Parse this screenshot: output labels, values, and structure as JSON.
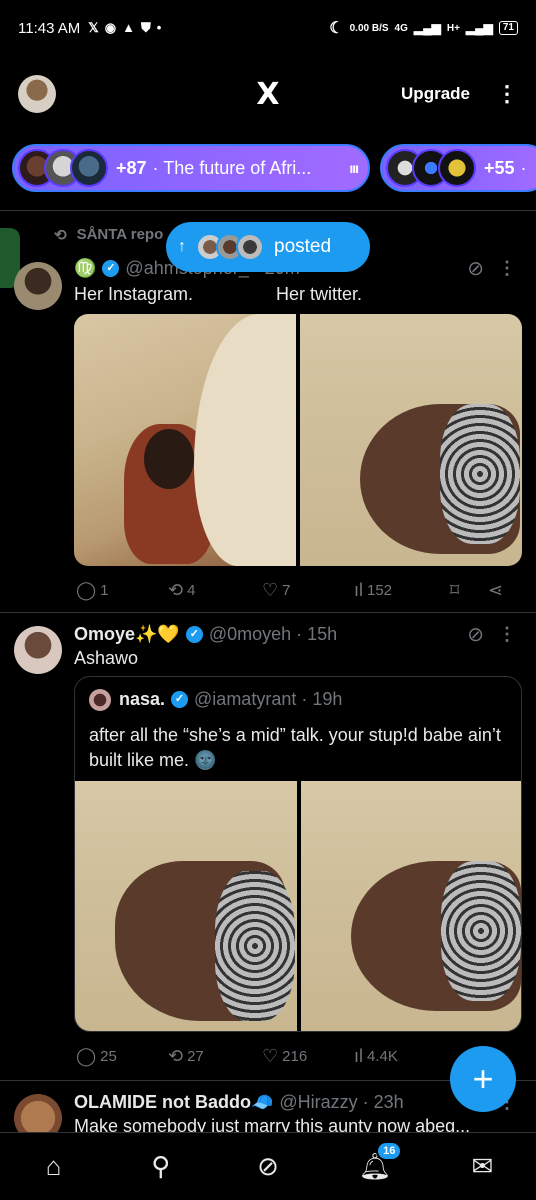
{
  "status_bar": {
    "time": "11:43 AM",
    "notif_icons": [
      "x-icon",
      "chat-icon",
      "warning-icon",
      "shield-icon"
    ],
    "data_speed": "0.00 B/S",
    "network": "4G",
    "network2": "H+",
    "battery": "71"
  },
  "header": {
    "logo": "X",
    "upgrade_label": "Upgrade"
  },
  "spaces": [
    {
      "count": "+87",
      "title": "· The future of Afri..."
    },
    {
      "count": "+55",
      "title": "·"
    }
  ],
  "posted_pill": {
    "label": "posted"
  },
  "feed": [
    {
      "repost_by": "SÅNTA repo",
      "name": "♍",
      "verified": true,
      "handle": "@ahmstopher_ · 20m",
      "text_left": "Her Instagram.",
      "text_right": "Her twitter.",
      "stats": {
        "replies": "1",
        "reposts": "4",
        "likes": "7",
        "views": "152"
      }
    },
    {
      "name": "Omoye✨💛",
      "verified": true,
      "handle": "@0moyeh · 15h",
      "text": "Ashawo",
      "quote": {
        "name": "nasa.",
        "verified": true,
        "handle": "@iamatyrant · 19h",
        "text": "after all the “she’s a mid” talk. your stup!d babe ain’t built like me. 🌚"
      },
      "stats": {
        "replies": "25",
        "reposts": "27",
        "likes": "216",
        "views": "4.4K"
      }
    },
    {
      "name": "OLAMIDE not Baddo🧢",
      "handle": "@Hirazzy · 23h",
      "text": "Make somebody just marry this aunty now abeg..."
    }
  ],
  "bottom_nav": {
    "notifications_badge": "16"
  },
  "colors": {
    "accent": "#1d9bf0",
    "background": "#000000",
    "muted": "#71767b"
  }
}
